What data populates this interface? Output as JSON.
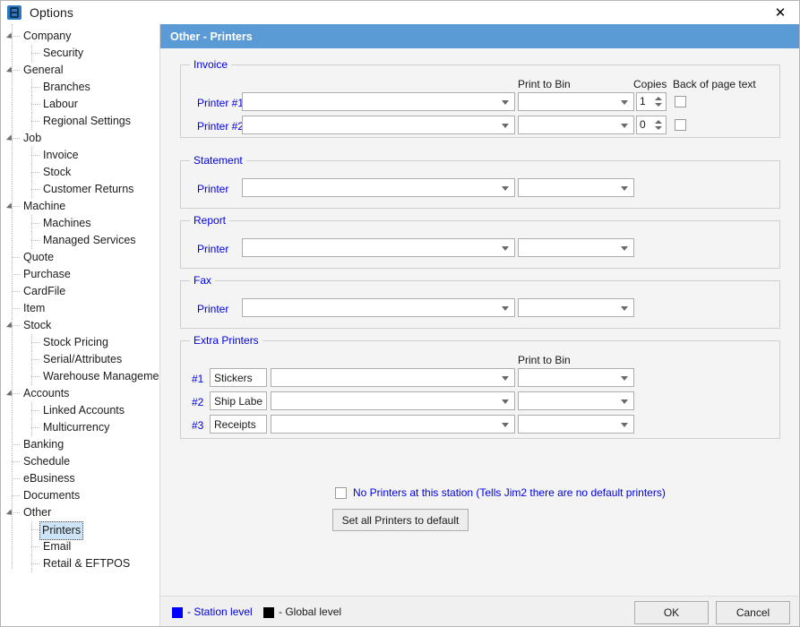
{
  "window": {
    "title": "Options",
    "icon": "options-app-icon",
    "close_label": "✕"
  },
  "sidebar": {
    "items": [
      {
        "label": "Company",
        "level": 0,
        "expandable": true,
        "selected": false
      },
      {
        "label": "Security",
        "level": 1,
        "expandable": false,
        "selected": false
      },
      {
        "label": "General",
        "level": 0,
        "expandable": true,
        "selected": false
      },
      {
        "label": "Branches",
        "level": 1,
        "expandable": false,
        "selected": false
      },
      {
        "label": "Labour",
        "level": 1,
        "expandable": false,
        "selected": false
      },
      {
        "label": "Regional Settings",
        "level": 1,
        "expandable": false,
        "selected": false
      },
      {
        "label": "Job",
        "level": 0,
        "expandable": true,
        "selected": false
      },
      {
        "label": "Invoice",
        "level": 1,
        "expandable": false,
        "selected": false
      },
      {
        "label": "Stock",
        "level": 1,
        "expandable": false,
        "selected": false
      },
      {
        "label": "Customer Returns",
        "level": 1,
        "expandable": false,
        "selected": false
      },
      {
        "label": "Machine",
        "level": 0,
        "expandable": true,
        "selected": false
      },
      {
        "label": "Machines",
        "level": 1,
        "expandable": false,
        "selected": false
      },
      {
        "label": "Managed Services",
        "level": 1,
        "expandable": false,
        "selected": false
      },
      {
        "label": "Quote",
        "level": 0,
        "expandable": false,
        "selected": false
      },
      {
        "label": "Purchase",
        "level": 0,
        "expandable": false,
        "selected": false
      },
      {
        "label": "CardFile",
        "level": 0,
        "expandable": false,
        "selected": false
      },
      {
        "label": "Item",
        "level": 0,
        "expandable": false,
        "selected": false
      },
      {
        "label": "Stock",
        "level": 0,
        "expandable": true,
        "selected": false
      },
      {
        "label": "Stock Pricing",
        "level": 1,
        "expandable": false,
        "selected": false
      },
      {
        "label": "Serial/Attributes",
        "level": 1,
        "expandable": false,
        "selected": false
      },
      {
        "label": "Warehouse Management",
        "level": 1,
        "expandable": false,
        "selected": false
      },
      {
        "label": "Accounts",
        "level": 0,
        "expandable": true,
        "selected": false
      },
      {
        "label": "Linked Accounts",
        "level": 1,
        "expandable": false,
        "selected": false
      },
      {
        "label": "Multicurrency",
        "level": 1,
        "expandable": false,
        "selected": false
      },
      {
        "label": "Banking",
        "level": 0,
        "expandable": false,
        "selected": false
      },
      {
        "label": "Schedule",
        "level": 0,
        "expandable": false,
        "selected": false
      },
      {
        "label": "eBusiness",
        "level": 0,
        "expandable": false,
        "selected": false
      },
      {
        "label": "Documents",
        "level": 0,
        "expandable": false,
        "selected": false
      },
      {
        "label": "Other",
        "level": 0,
        "expandable": true,
        "selected": false
      },
      {
        "label": "Printers",
        "level": 1,
        "expandable": false,
        "selected": true
      },
      {
        "label": "Email",
        "level": 1,
        "expandable": false,
        "selected": false
      },
      {
        "label": "Retail & EFTPOS",
        "level": 1,
        "expandable": false,
        "selected": false
      }
    ]
  },
  "pane": {
    "header_title": "Other - Printers"
  },
  "invoice": {
    "legend": "Invoice",
    "col_print_to_bin": "Print to Bin",
    "col_copies": "Copies",
    "col_back_of_page": "Back of page text",
    "rows": [
      {
        "label": "Printer #1",
        "printer": "",
        "bin": "",
        "copies": "1",
        "back_of_page": false
      },
      {
        "label": "Printer #2",
        "printer": "",
        "bin": "",
        "copies": "0",
        "back_of_page": false
      }
    ]
  },
  "statement": {
    "legend": "Statement",
    "row_label": "Printer",
    "printer": "",
    "bin": ""
  },
  "report": {
    "legend": "Report",
    "row_label": "Printer",
    "printer": "",
    "bin": ""
  },
  "fax": {
    "legend": "Fax",
    "row_label": "Printer",
    "printer": "",
    "bin": ""
  },
  "extra_printers": {
    "legend": "Extra Printers",
    "col_print_to_bin": "Print to Bin",
    "rows": [
      {
        "index": "#1",
        "name": "Stickers",
        "printer": "",
        "bin": ""
      },
      {
        "index": "#2",
        "name": "Ship Labels",
        "printer": "",
        "bin": ""
      },
      {
        "index": "#3",
        "name": "Receipts",
        "printer": "",
        "bin": ""
      }
    ]
  },
  "options": {
    "no_printers_label": "No Printers at this station (Tells Jim2 there are no default printers)",
    "no_printers_checked": false,
    "set_default_button": "Set all Printers to default"
  },
  "footer": {
    "station_level_text": "- Station level",
    "global_level_text": "- Global level",
    "station_level_color": "#0000ff",
    "global_level_color": "#000000",
    "ok_label": "OK",
    "cancel_label": "Cancel"
  },
  "colors": {
    "accent_header": "#5b9bd5",
    "station_blue": "#0000e0",
    "selection": "#cde4f7",
    "pane_bg": "#f4f4f4",
    "footer_bg": "#f0f0f0"
  }
}
